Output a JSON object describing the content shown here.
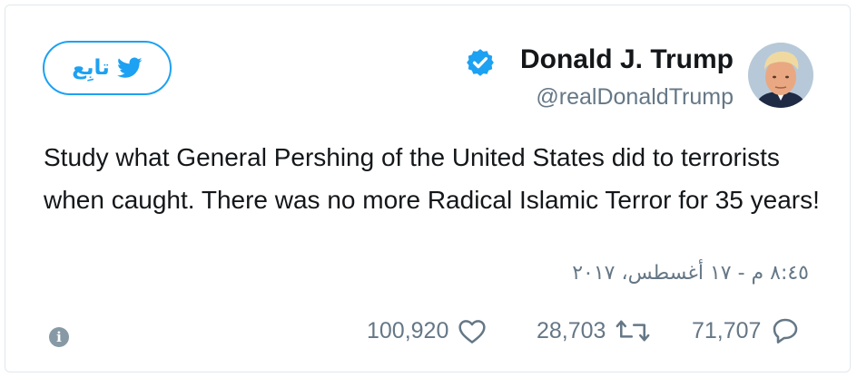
{
  "author": {
    "name": "Donald J. Trump",
    "handle": "@realDonaldTrump",
    "verified": true,
    "avatar_icon": "profile-photo"
  },
  "follow_button": {
    "label": "تابِع",
    "icon": "twitter-bird-icon"
  },
  "tweet": {
    "text": "Study what General Pershing of the United States did to terrorists when caught. There was no more Radical Islamic Terror for 35 years!",
    "timestamp": "٨:٤٥ م - ١٧ أغسطس، ٢٠١٧"
  },
  "actions": {
    "likes": "100,920",
    "retweets": "28,703",
    "replies": "71,707"
  },
  "colors": {
    "accent": "#1da1f2",
    "text": "#14171a",
    "secondary": "#657786",
    "border": "#e1e8ed"
  }
}
